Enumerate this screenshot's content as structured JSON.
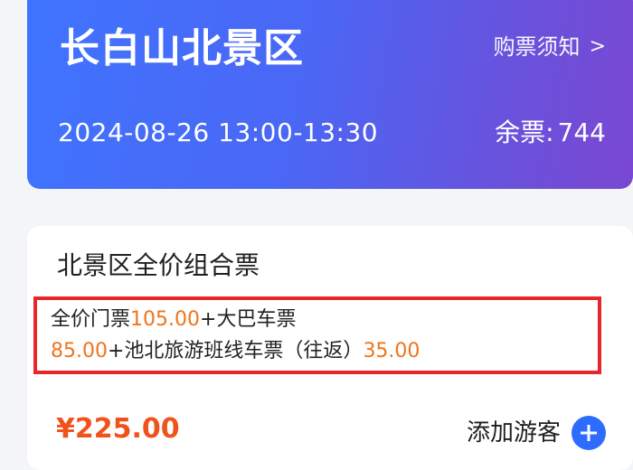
{
  "header": {
    "title": "长白山北景区",
    "notice_label": "购票须知",
    "notice_chevron": ">",
    "date_time": "2024-08-26 13:00-13:30",
    "remaining_label": "余票:",
    "remaining_count": "744",
    "gradient_colors": [
      "#3f74ff",
      "#7a48d2"
    ]
  },
  "ticket": {
    "name": "北景区全价组合票",
    "details": {
      "part1_label": "全价门票",
      "part1_amount": "105.00",
      "plus1": "+",
      "part2_label": "大巴车票",
      "part2_amount": "85.00",
      "plus2": "+",
      "part3_label": "池北旅游班线车票（往返）",
      "part3_amount": "35.00"
    },
    "price": "¥225.00",
    "add_guest_label": "添加游客",
    "add_icon": "plus-circle-icon",
    "colors": {
      "amount": "#f0741c",
      "price": "#f0521c",
      "highlight_border": "#e6262b",
      "add_button": "#2e6bff"
    }
  }
}
